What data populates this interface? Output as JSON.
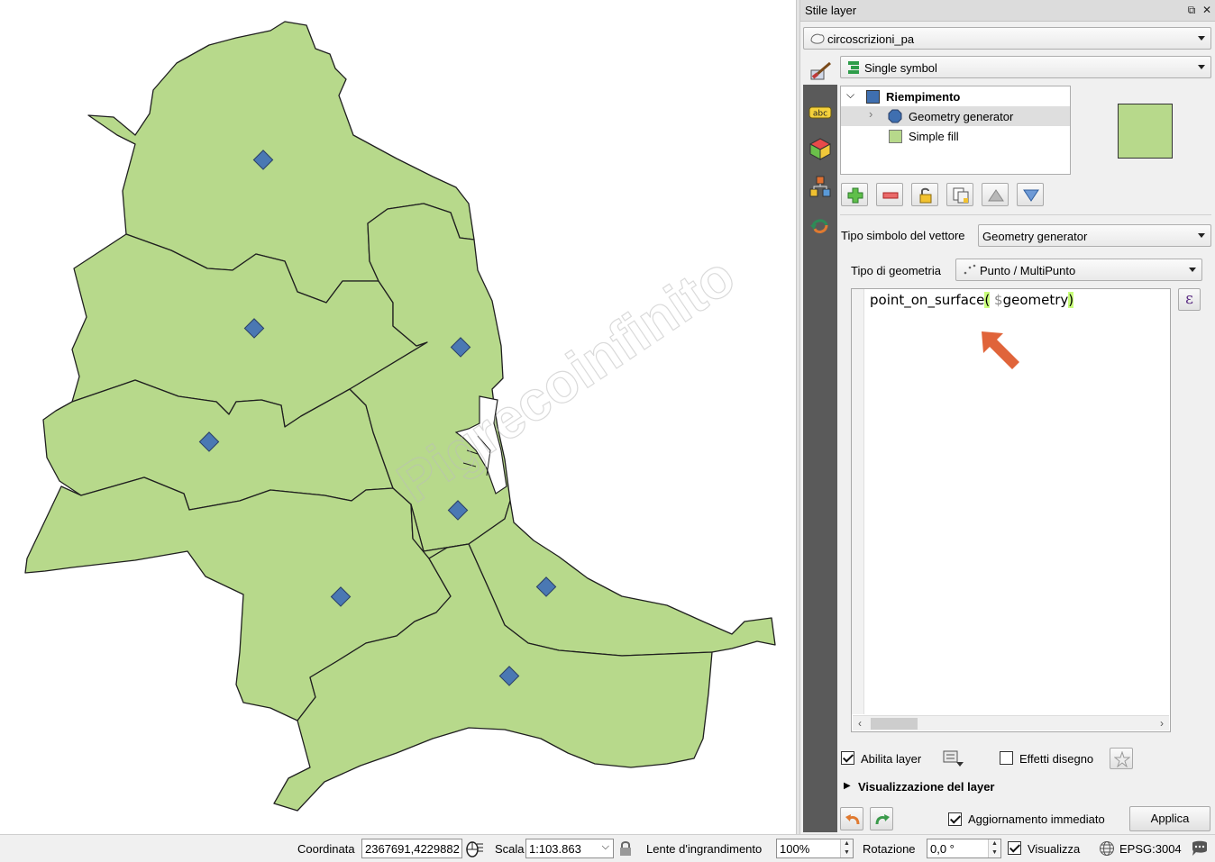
{
  "map": {
    "watermark": "Pigrecoinfinito",
    "fill_color": "#b7d98b",
    "marker_color": "#4a78b3"
  },
  "panel": {
    "title": "Stile layer",
    "layer_select": "circoscrizioni_pa",
    "renderer_select": "Single symbol",
    "symbol_tree": {
      "root": "Riempimento",
      "child1": "Geometry generator",
      "child2": "Simple fill"
    },
    "symbol_type_label": "Tipo simbolo del vettore",
    "symbol_type_value": "Geometry generator",
    "geometry_type_label": "Tipo di geometria",
    "geometry_type_value": "Punto / MultiPunto",
    "expression": {
      "func": "point_on_surface",
      "open": "(",
      "space": " ",
      "var": "$geometry",
      "close": ")"
    },
    "expr_button": "ε",
    "enable_layer": "Abilita layer",
    "draw_effects": "Effetti disegno",
    "layer_rendering": "Visualizzazione del layer",
    "live_update": "Aggiornamento immediato",
    "apply": "Applica",
    "accent_arrow": "#e0643a"
  },
  "status": {
    "coord_label": "Coordinata",
    "coord_value": "2367691,4229882",
    "scale_label": "Scala",
    "scale_value": "1:103.863",
    "magnifier_label": "Lente d'ingrandimento",
    "magnifier_value": "100%",
    "rotation_label": "Rotazione",
    "rotation_value": "0,0 °",
    "render_label": "Visualizza",
    "crs": "EPSG:3004"
  }
}
